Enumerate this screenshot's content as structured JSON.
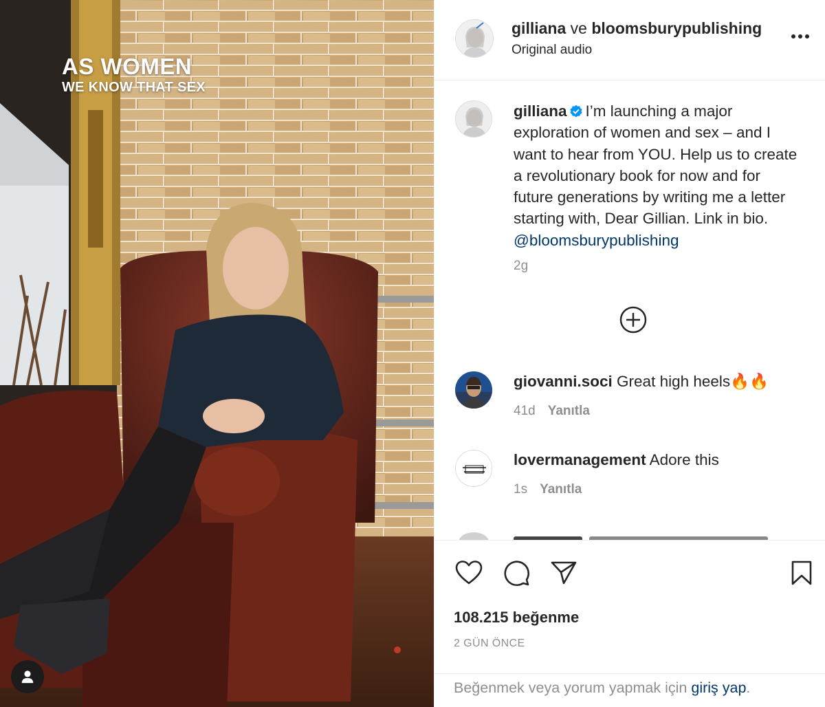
{
  "media": {
    "overlay_line1": "AS WOMEN",
    "overlay_line2": "WE KNOW THAT SEX"
  },
  "header": {
    "user1": "gilliana",
    "conjunction": "ve",
    "user2": "bloomsburypublishing",
    "audio": "Original audio"
  },
  "caption": {
    "username": "gilliana",
    "text": "I’m launching a major exploration of women and sex – and I want to hear from YOU. Help us to create a revolutionary book for now and for future generations by writing me a letter starting with, Dear Gillian. Link in bio.",
    "mention": "@bloomsburypublishing",
    "time": "2g"
  },
  "comments": [
    {
      "username": "giovanni.soci",
      "text": "Great high heels🔥🔥",
      "time": "41d",
      "reply": "Yanıtla"
    },
    {
      "username": "lovermanagement",
      "text": "Adore this",
      "time": "1s",
      "reply": "Yanıtla"
    }
  ],
  "footer": {
    "likes": "108.215 beğenme",
    "date": "2 GÜN ÖNCE",
    "login_prefix": "Beğenmek veya yorum yapmak için",
    "login_link": "giriş yap",
    "login_suffix": "."
  },
  "colors": {
    "link": "#00376b",
    "muted": "#8e8e8e",
    "verified": "#0095f6"
  }
}
